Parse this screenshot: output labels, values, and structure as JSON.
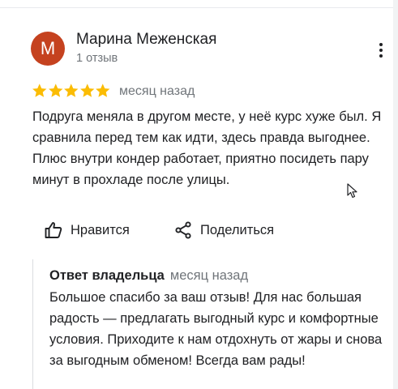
{
  "review": {
    "avatar_letter": "М",
    "avatar_color": "#c5421f",
    "author_name": "Марина Меженская",
    "author_reviews": "1 отзыв",
    "rating": 5,
    "max_rating": 5,
    "star_color": "#fbbc04",
    "date": "месяц назад",
    "text": "Подруга меняла в другом месте, у неё курс хуже был. Я сравнила перед тем как идти, здесь правда выгоднее. Плюс внутри кондер работает, приятно посидеть пару минут в прохладе после улицы.",
    "menu_icon": "more-vertical-icon"
  },
  "actions": {
    "like_label": "Нравится",
    "like_icon": "thumb-up-icon",
    "share_label": "Поделиться",
    "share_icon": "share-icon"
  },
  "owner_reply": {
    "title": "Ответ владельца",
    "date": "месяц назад",
    "text": "Большое спасибо за ваш отзыв! Для нас большая радость — предлагать выгодный курс и комфортные условия. Приходите к нам отдохнуть от жары и снова за выгодным обменом! Всегда вам рады!"
  }
}
